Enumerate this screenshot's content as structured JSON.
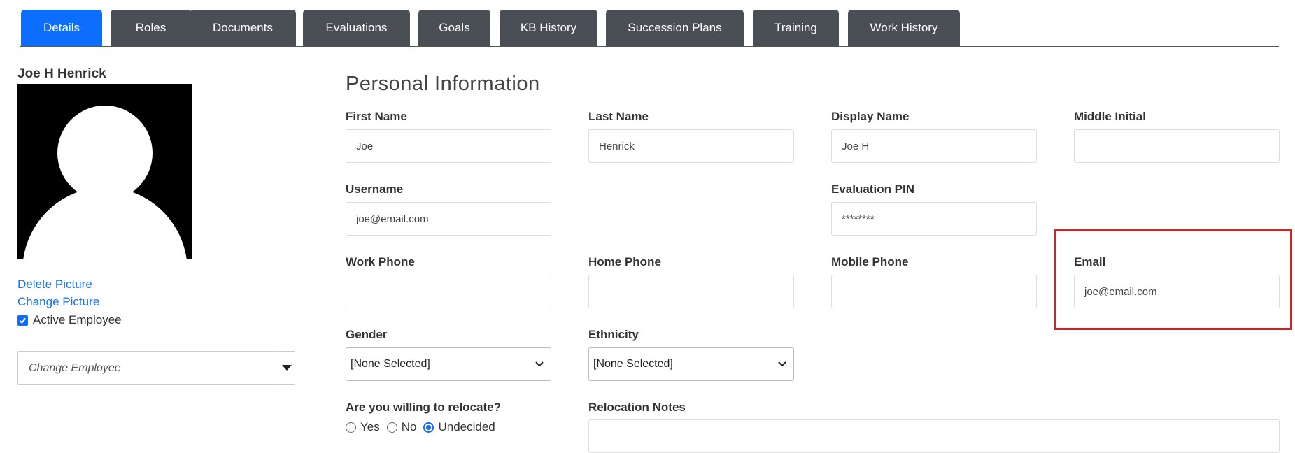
{
  "tabs": [
    {
      "label": "Details",
      "active": true
    },
    {
      "label": "Roles"
    },
    {
      "label": "Documents"
    },
    {
      "label": "Evaluations"
    },
    {
      "label": "Goals"
    },
    {
      "label": "KB History"
    },
    {
      "label": "Succession Plans"
    },
    {
      "label": "Training"
    },
    {
      "label": "Work History"
    }
  ],
  "employee": {
    "name": "Joe H Henrick",
    "delete_picture": "Delete Picture",
    "change_picture": "Change Picture",
    "active_label": "Active Employee",
    "active_checked": true,
    "change_employee_placeholder": "Change Employee"
  },
  "form": {
    "title": "Personal Information",
    "first_name": {
      "label": "First Name",
      "value": "Joe"
    },
    "last_name": {
      "label": "Last Name",
      "value": "Henrick"
    },
    "display_name": {
      "label": "Display Name",
      "value": "Joe H"
    },
    "middle_initial": {
      "label": "Middle Initial",
      "value": ""
    },
    "username": {
      "label": "Username",
      "value": "joe@email.com"
    },
    "evaluation_pin": {
      "label": "Evaluation PIN",
      "value": "********"
    },
    "work_phone": {
      "label": "Work Phone",
      "value": ""
    },
    "home_phone": {
      "label": "Home Phone",
      "value": ""
    },
    "mobile_phone": {
      "label": "Mobile Phone",
      "value": ""
    },
    "email": {
      "label": "Email",
      "value": "joe@email.com"
    },
    "gender": {
      "label": "Gender",
      "value": "[None Selected]"
    },
    "ethnicity": {
      "label": "Ethnicity",
      "value": "[None Selected]"
    },
    "relocate": {
      "label": "Are you willing to relocate?",
      "options": [
        "Yes",
        "No",
        "Undecided"
      ],
      "selected": "Undecided"
    },
    "relocation_notes": {
      "label": "Relocation Notes",
      "value": ""
    }
  },
  "colors": {
    "accent": "#0d6efd",
    "tab": "#4a4f55",
    "highlight": "#c62828",
    "link": "#1a73e8"
  }
}
